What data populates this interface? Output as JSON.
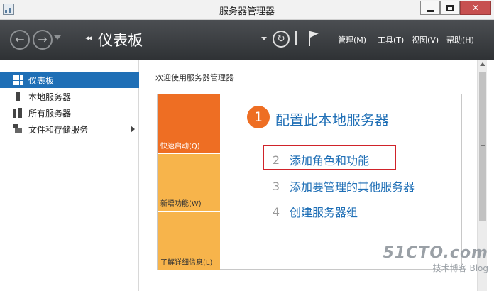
{
  "window": {
    "title": "服务器管理器",
    "minimize": "",
    "maximize": "",
    "close": "✕"
  },
  "nav": {
    "back_icon": "back-arrow",
    "forward_icon": "forward-arrow",
    "breadcrumb_arrows": "◂◂",
    "page_title": "仪表板",
    "menus": [
      "管理(M)",
      "工具(T)",
      "视图(V)",
      "帮助(H)"
    ]
  },
  "sidebar": {
    "items": [
      {
        "label": "仪表板",
        "icon": "dashboard-icon",
        "active": true
      },
      {
        "label": "本地服务器",
        "icon": "server-icon"
      },
      {
        "label": "所有服务器",
        "icon": "servers-icon"
      },
      {
        "label": "文件和存储服务",
        "icon": "storage-icon",
        "has_children": true
      }
    ]
  },
  "main": {
    "welcome": "欢迎使用服务器管理器",
    "tiles": [
      "快速启动(Q)",
      "新增功能(W)",
      "了解详细信息(L)"
    ],
    "step1": {
      "number": "1",
      "text": "配置此本地服务器"
    },
    "steps": [
      {
        "number": "2",
        "text": "添加角色和功能"
      },
      {
        "number": "3",
        "text": "添加要管理的其他服务器"
      },
      {
        "number": "4",
        "text": "创建服务器组"
      }
    ]
  },
  "watermark": {
    "site": "51CTO.com",
    "sub": "技术博客",
    "blog": "Blog"
  },
  "colors": {
    "accent_blue": "#1f6fb6",
    "tile_orange": "#ee6e23",
    "tile_yellow": "#f7b44b",
    "highlight_red": "#d0232a"
  }
}
